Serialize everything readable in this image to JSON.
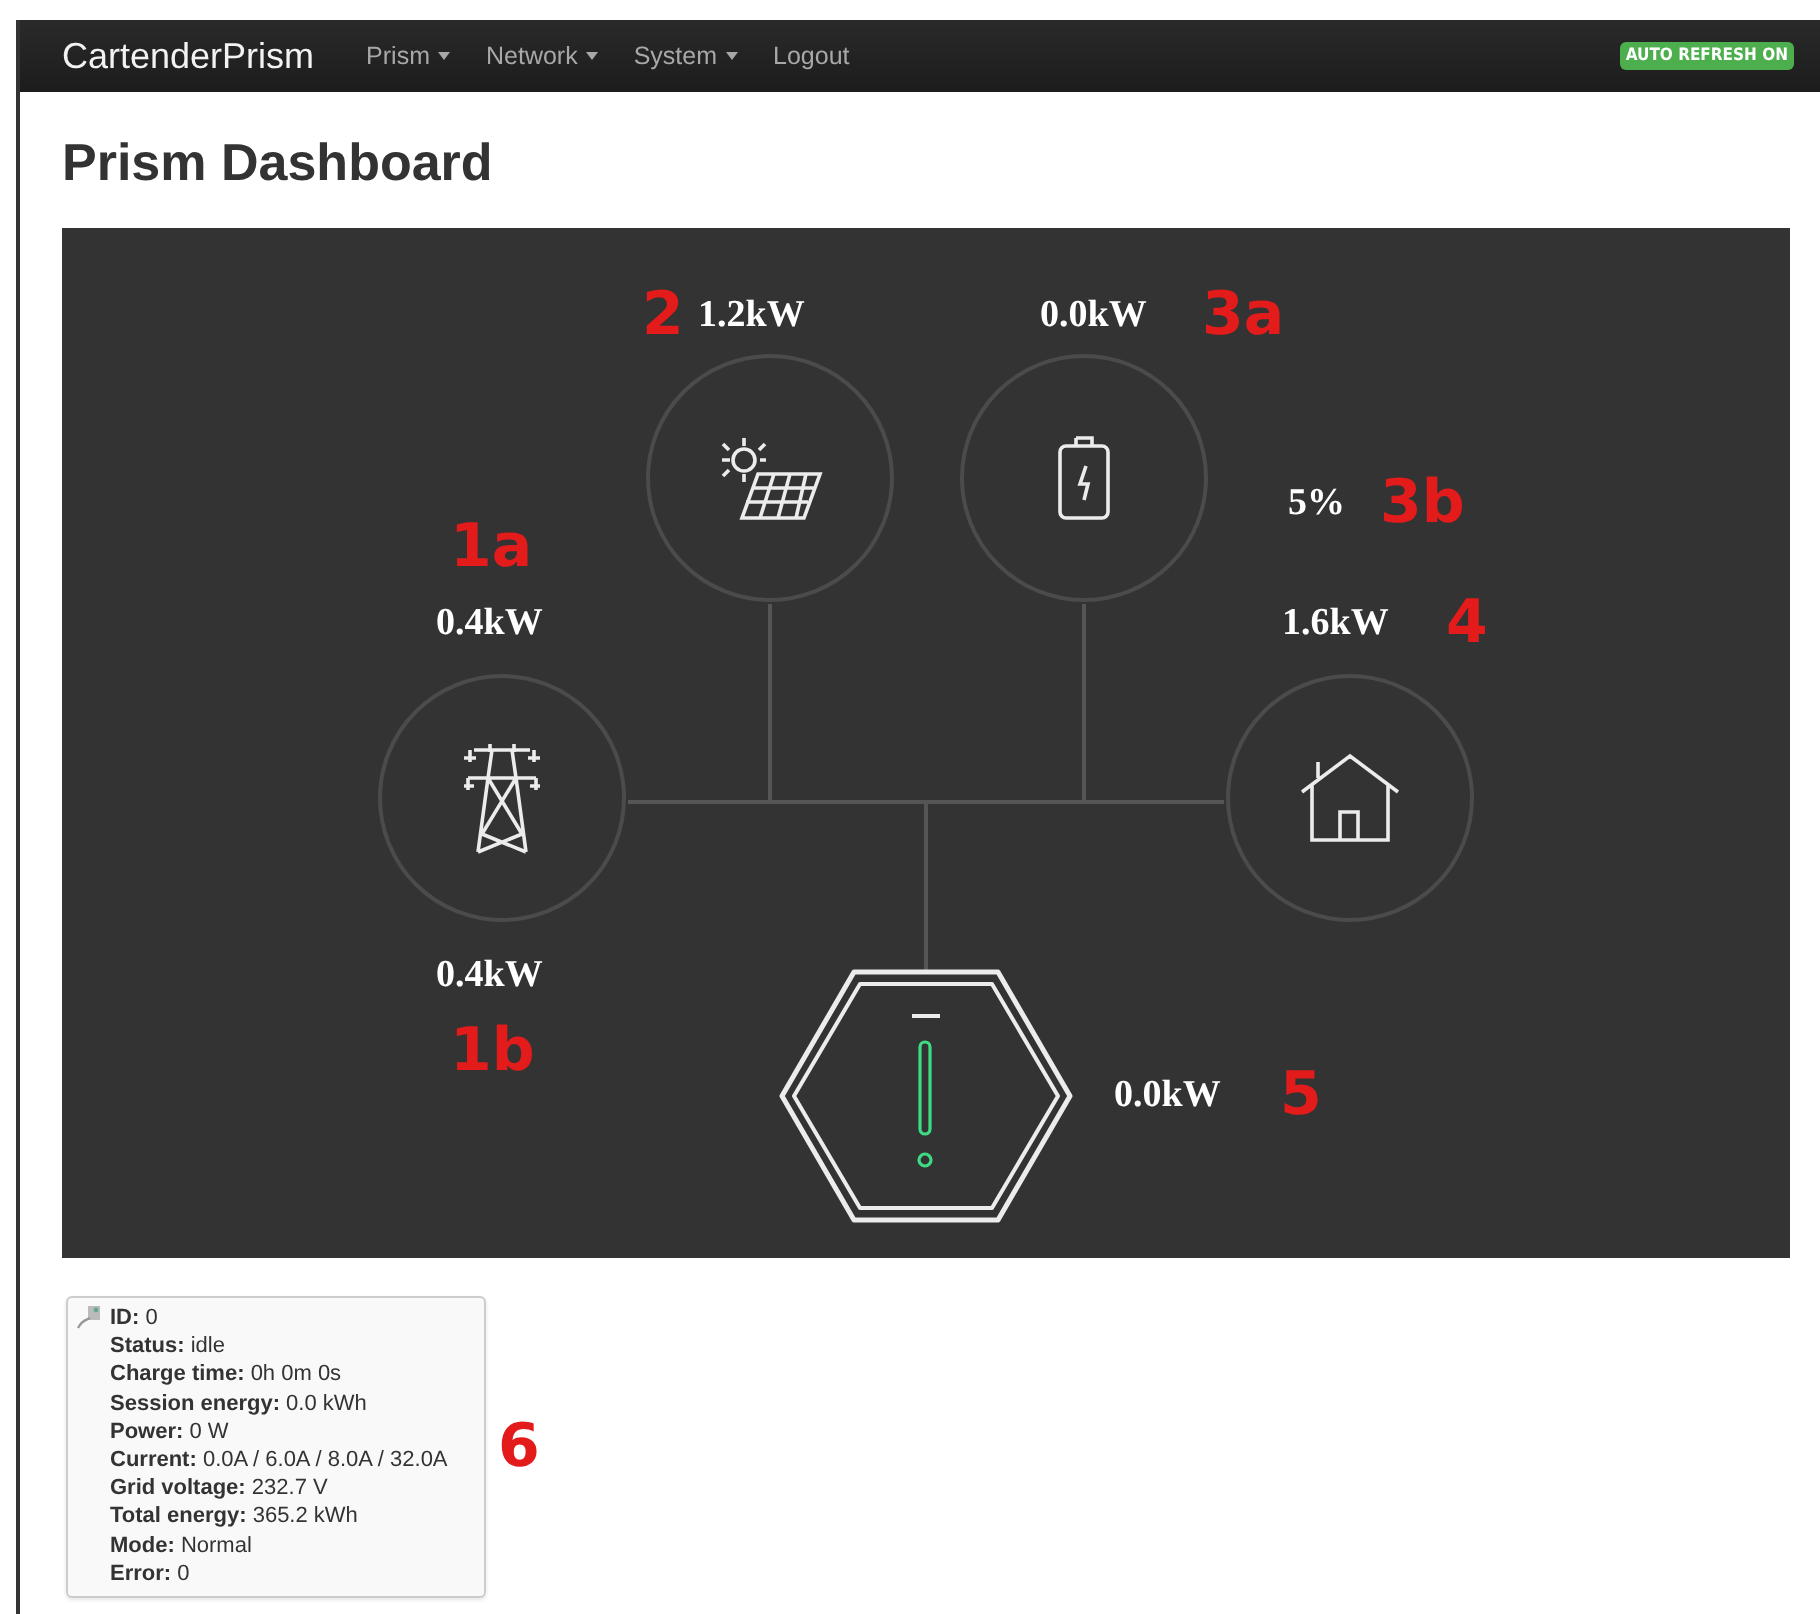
{
  "navbar": {
    "brand": "CartenderPrism",
    "menu": [
      {
        "label": "Prism",
        "dropdown": true
      },
      {
        "label": "Network",
        "dropdown": true
      },
      {
        "label": "System",
        "dropdown": true
      },
      {
        "label": "Logout",
        "dropdown": false
      }
    ],
    "badge": "AUTO REFRESH ON"
  },
  "title": "Prism Dashboard",
  "diagram": {
    "readings": {
      "solar": "1.2kW",
      "battery_power": "0.0kW",
      "battery_soc": "5%",
      "grid_top": "0.4kW",
      "house": "1.6kW",
      "grid_bottom": "0.4kW",
      "charger": "0.0kW"
    },
    "annotations": {
      "solar": "2",
      "battery_power": "3a",
      "battery_soc": "3b",
      "grid_top": "1a",
      "house": "4",
      "grid_bottom": "1b",
      "charger": "5"
    }
  },
  "charger_info": {
    "annotation": "6",
    "fields": [
      {
        "label": "ID:",
        "value": "0"
      },
      {
        "label": "Status:",
        "value": "idle"
      },
      {
        "label": "Charge time:",
        "value": "0h 0m 0s"
      },
      {
        "label": "Session energy:",
        "value": "0.0 kWh"
      },
      {
        "label": "Power:",
        "value": "0 W"
      },
      {
        "label": "Current:",
        "value": "0.0A / 6.0A / 8.0A / 32.0A"
      },
      {
        "label": "Grid voltage:",
        "value": "232.7 V"
      },
      {
        "label": "Total energy:",
        "value": "365.2 kWh"
      },
      {
        "label": "Mode:",
        "value": "Normal"
      },
      {
        "label": "Error:",
        "value": "0"
      }
    ]
  }
}
